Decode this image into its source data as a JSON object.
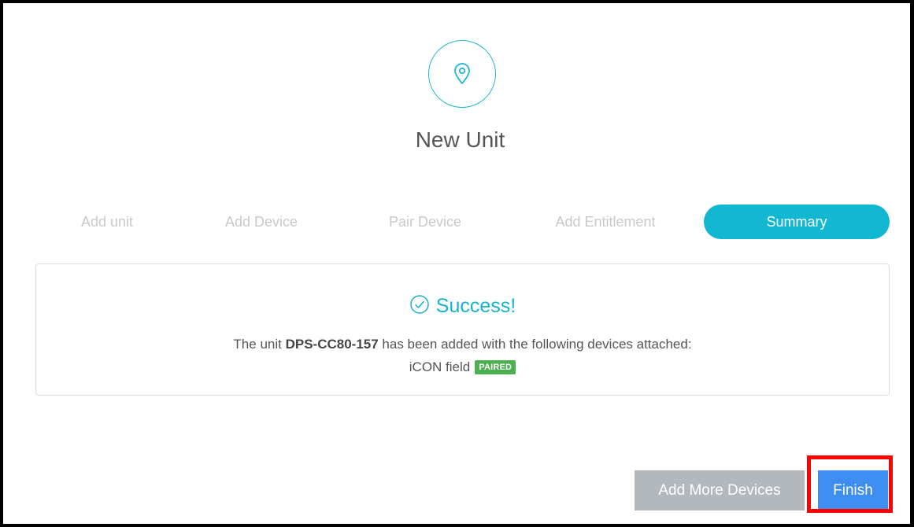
{
  "header": {
    "icon": "map-pin-icon",
    "title": "New Unit"
  },
  "steps": [
    {
      "label": "Add unit",
      "active": false
    },
    {
      "label": "Add Device",
      "active": false
    },
    {
      "label": "Pair Device",
      "active": false
    },
    {
      "label": "Add Entitlement",
      "active": false
    },
    {
      "label": "Summary",
      "active": true
    }
  ],
  "summary": {
    "success_icon": "check-circle-icon",
    "success_label": "Success!",
    "message_prefix": "The unit ",
    "unit_name": "DPS-CC80-157",
    "message_suffix": " has been added with the following devices attached:",
    "devices": [
      {
        "name": "iCON field",
        "status": "PAIRED"
      }
    ]
  },
  "actions": {
    "add_more_label": "Add More Devices",
    "finish_label": "Finish"
  },
  "colors": {
    "accent": "#12b8d2",
    "primary_button": "#3d8ef0",
    "disabled_button": "#b3b8bd",
    "paired_badge": "#4caf50",
    "highlight": "#ff0000"
  }
}
